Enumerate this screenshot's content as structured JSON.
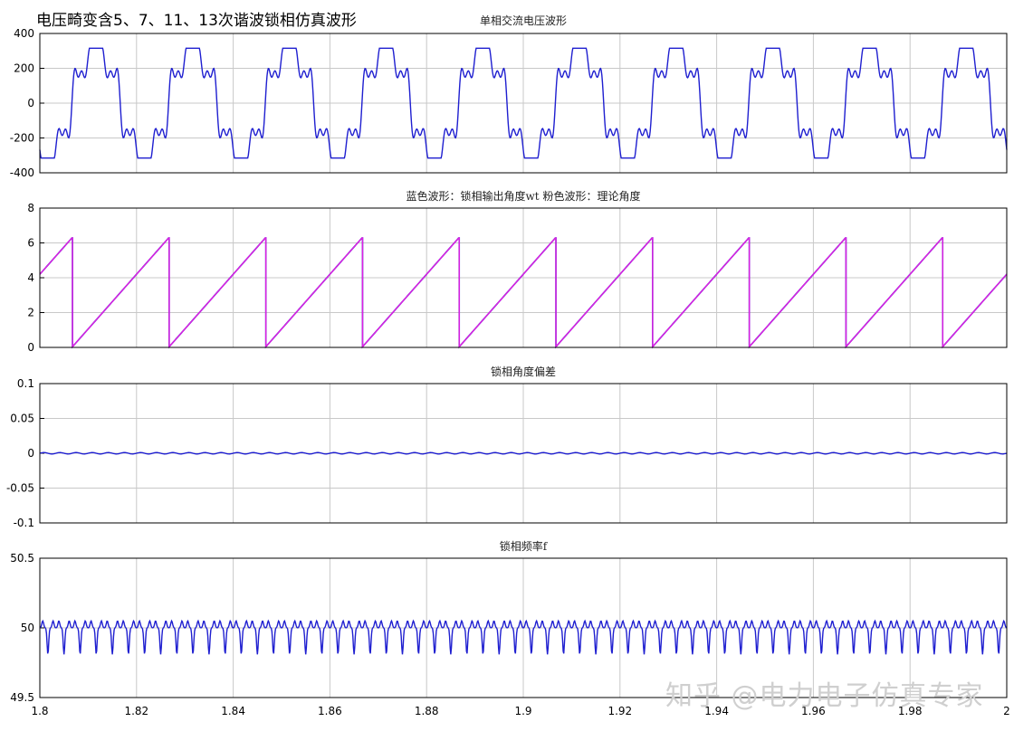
{
  "figure": {
    "main_title": "电压畸变含5、7、11、13次谐波锁相仿真波形",
    "watermark": "知乎 @电力电子仿真专家"
  },
  "chart_data": [
    {
      "type": "line",
      "title": "单相交流电压波形",
      "xlim": [
        1.8,
        2.0
      ],
      "ylim": [
        -400,
        400
      ],
      "yticks": [
        400,
        200,
        0,
        -200,
        -400
      ],
      "grid": true,
      "series": [
        {
          "color": "#1f1fd0",
          "waveform": {
            "kind": "distorted-sine",
            "frequency_hz": 50,
            "peak": 315,
            "phase_rad": 4.2
          }
        }
      ]
    },
    {
      "type": "line",
      "title": "蓝色波形：锁相输出角度wt  粉色波形：理论角度",
      "xlim": [
        1.8,
        2.0
      ],
      "ylim": [
        0,
        8
      ],
      "yticks": [
        8,
        6,
        4,
        2,
        0
      ],
      "grid": true,
      "series": [
        {
          "color": "#1f1fd0",
          "waveform": {
            "kind": "sawtooth",
            "frequency_hz": 50,
            "min": 0,
            "max": 6.283,
            "phase_rad": 4.2
          }
        },
        {
          "color": "#e020e0",
          "waveform": {
            "kind": "sawtooth",
            "frequency_hz": 50,
            "min": 0,
            "max": 6.283,
            "phase_rad": 4.2
          }
        }
      ]
    },
    {
      "type": "line",
      "title": "锁相角度偏差",
      "xlim": [
        1.8,
        2.0
      ],
      "ylim": [
        -0.1,
        0.1
      ],
      "yticks": [
        "0.1",
        "0.05",
        "0",
        "-0.05",
        "-0.1"
      ],
      "grid": true,
      "series": [
        {
          "color": "#1f1fd0",
          "waveform": {
            "kind": "ripple",
            "offset": 0,
            "amplitude": 0.001,
            "frequency_hz": 300
          }
        }
      ]
    },
    {
      "type": "line",
      "title": "锁相频率f",
      "xlim": [
        1.8,
        2.0
      ],
      "ylim": [
        49.5,
        50.5
      ],
      "yticks": [
        "50.5",
        "50",
        "49.5"
      ],
      "xticks": [
        "1.8",
        "1.82",
        "1.84",
        "1.86",
        "1.88",
        "1.9",
        "1.92",
        "1.94",
        "1.96",
        "1.98",
        "2"
      ],
      "grid": true,
      "series": [
        {
          "color": "#1f1fd0",
          "waveform": {
            "kind": "frequency-ripple",
            "center": 50,
            "frequency_hz": 300,
            "peak_high": 50.1,
            "peak_low": 49.81
          }
        }
      ]
    }
  ]
}
